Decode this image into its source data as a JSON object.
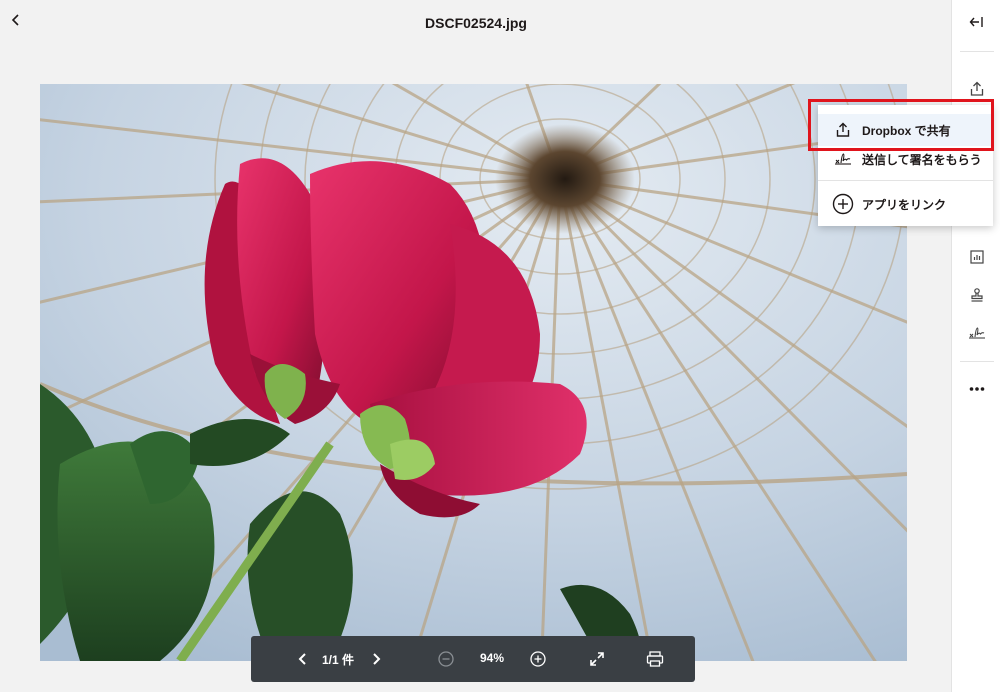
{
  "header": {
    "title": "DSCF02524.jpg",
    "back_icon": "chevron-left-icon"
  },
  "sidebar": {
    "collapse_icon": "collapse-panel-icon",
    "items": [
      {
        "icon": "share-icon"
      },
      {
        "icon": "chart-icon"
      },
      {
        "icon": "stamp-icon"
      },
      {
        "icon": "signature-icon"
      },
      {
        "icon": "more-icon"
      }
    ]
  },
  "share_menu": {
    "items": [
      {
        "label": "Dropbox で共有",
        "icon": "share-icon"
      },
      {
        "label": "送信して署名をもらう",
        "icon": "signature-icon"
      },
      {
        "label": "アプリをリンク",
        "icon": "plus-circle-icon"
      }
    ]
  },
  "toolbar": {
    "page_indicator": "1/1 件",
    "zoom": "94%"
  },
  "colors": {
    "highlight": "#e0141c",
    "toolbar_bg": "#3a3f44",
    "flower": "#d11b4e"
  }
}
